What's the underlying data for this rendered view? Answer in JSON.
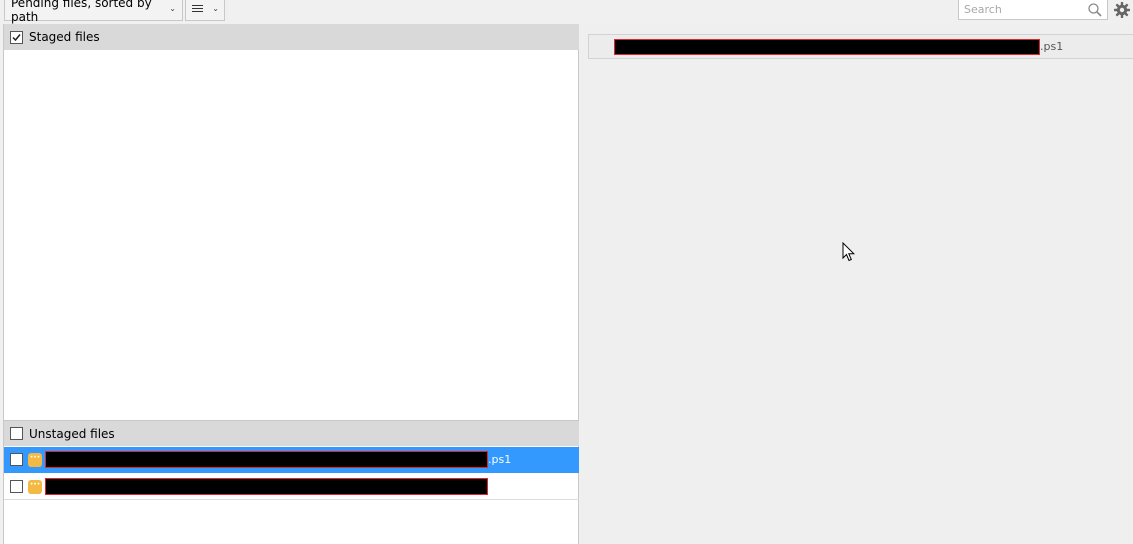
{
  "toolbar": {
    "view_mode": "Pending files, sorted by path",
    "search_placeholder": "Search"
  },
  "staged": {
    "label": "Staged files",
    "checked": true
  },
  "unstaged": {
    "label": "Unstaged files",
    "checked": false,
    "files": [
      {
        "extension": ".ps1",
        "selected": true,
        "status": "modified"
      },
      {
        "extension": "",
        "selected": false,
        "status": "modified"
      }
    ]
  },
  "diff": {
    "file_extension": ".ps1"
  },
  "colors": {
    "selection": "#3399ff",
    "status_modified": "#f4b942",
    "redaction_border": "#e0262c"
  }
}
